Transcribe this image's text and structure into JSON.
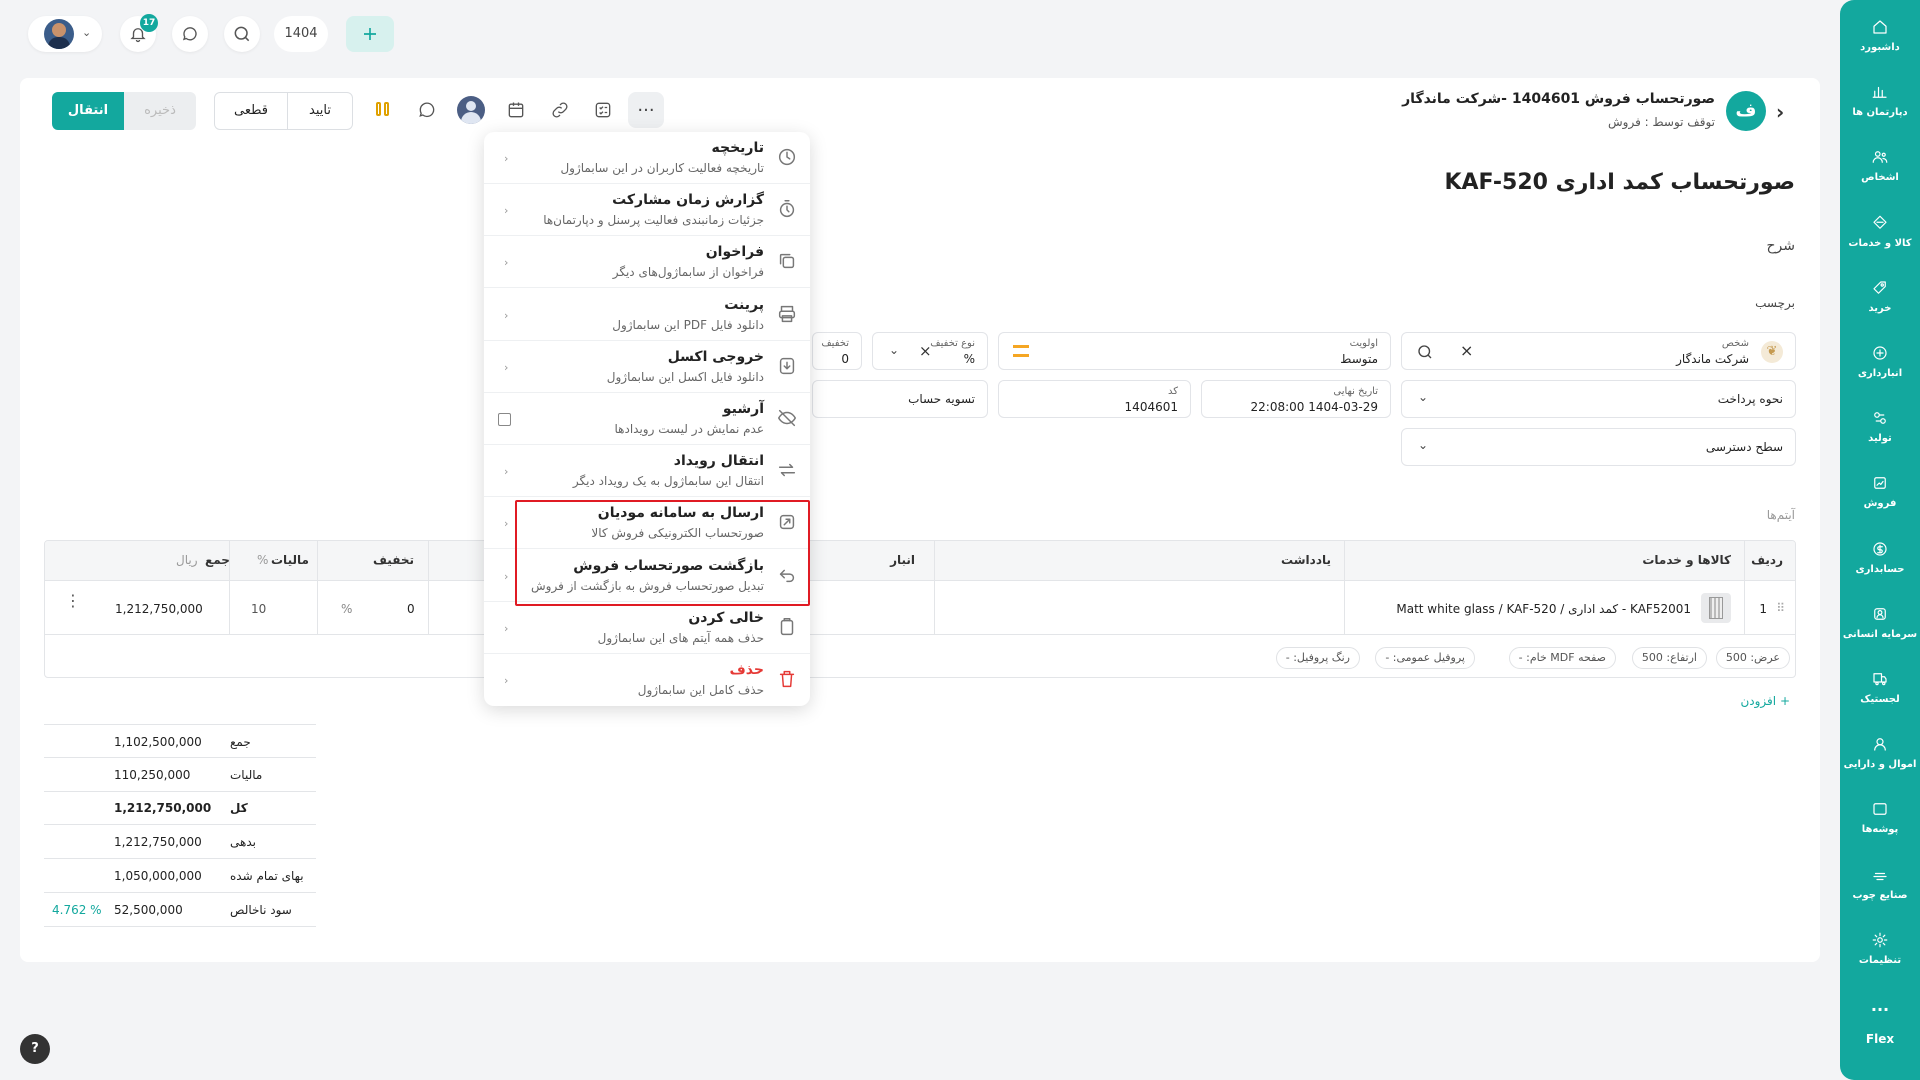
{
  "topbar": {
    "notif_count": "17",
    "year": "1404"
  },
  "sidebar": [
    {
      "label": "داشبورد",
      "icon": "home-icon"
    },
    {
      "label": "دپارتمان ها",
      "icon": "chart-icon"
    },
    {
      "label": "اشخاص",
      "icon": "users-icon"
    },
    {
      "label": "کالا و خدمات",
      "icon": "box-icon"
    },
    {
      "label": "خرید",
      "icon": "tag-icon"
    },
    {
      "label": "انبارداری",
      "icon": "warehouse-icon"
    },
    {
      "label": "تولید",
      "icon": "factory-icon"
    },
    {
      "label": "فروش",
      "icon": "sales-icon"
    },
    {
      "label": "حسابداری",
      "icon": "dollar-icon"
    },
    {
      "label": "سرمایه انسانی",
      "icon": "person-icon"
    },
    {
      "label": "لجستیک",
      "icon": "truck-icon"
    },
    {
      "label": "اموال و دارایی",
      "icon": "asset-icon"
    },
    {
      "label": "پوشه‌ها",
      "icon": "folder-icon"
    },
    {
      "label": "صنایع چوب",
      "icon": "wood-icon"
    },
    {
      "label": "تنظیمات",
      "icon": "gear-icon"
    }
  ],
  "sidebar_more": "...",
  "brand": "Flex",
  "header": {
    "avatar_letter": "ف",
    "title": "صورتحساب فروش 1404601 -شرکت ماندگار",
    "subtitle": "توقف توسط : فروش"
  },
  "actions": {
    "transfer": "انتقال",
    "save": "ذخیره",
    "approve": "تایید",
    "final": "قطعی"
  },
  "page_title": "صورتحساب کمد اداری KAF-520",
  "labels": {
    "description": "شرح",
    "tag": "برچسب"
  },
  "fields": {
    "person": {
      "label": "شخص",
      "value": "شرکت ماندگار"
    },
    "priority": {
      "label": "اولویت",
      "value": "متوسط"
    },
    "discount_type": {
      "label": "نوع تخفیف",
      "value": "%"
    },
    "discount": {
      "label": "تخفیف",
      "value": "0"
    },
    "payment": {
      "label": "نحوه پرداخت"
    },
    "due_date": {
      "label": "تاریخ نهایی",
      "value": "1404-03-29 22:08:00"
    },
    "code": {
      "label": "کد",
      "value": "1404601"
    },
    "settlement": {
      "value": "تسویه حساب"
    },
    "access": {
      "label": "سطح دسترسی"
    }
  },
  "menu": [
    {
      "title": "تاریخچه",
      "sub": "تاریخچه فعالیت کاربران در این سابماژول",
      "icon": "clock-icon"
    },
    {
      "title": "گزارش زمان مشارکت",
      "sub": "جزئیات زمانبندی فعالیت پرسنل و دپارتمان‌ها",
      "icon": "timer-icon"
    },
    {
      "title": "فراخوان",
      "sub": "فراخوان از سابماژول‌های دیگر",
      "icon": "copy-icon"
    },
    {
      "title": "پرینت",
      "sub": "دانلود فایل PDF این سابماژول",
      "icon": "printer-icon"
    },
    {
      "title": "خروجی اکسل",
      "sub": "دانلود فایل اکسل این سابماژول",
      "icon": "download-icon"
    },
    {
      "title": "آرشیو",
      "sub": "عدم نمایش در لیست رویدادها",
      "icon": "eye-off-icon"
    },
    {
      "title": "انتقال رویداد",
      "sub": "انتقال این سابماژول به یک رویداد دیگر",
      "icon": "swap-icon"
    },
    {
      "title": "ارسال به سامانه مودیان",
      "sub": "صورتحساب الکترونیکی فروش کالا",
      "icon": "send-icon"
    },
    {
      "title": "بازگشت صورتحساب فروش",
      "sub": "تبدیل صورتحساب فروش به بازگشت از فروش",
      "icon": "return-icon"
    },
    {
      "title": "خالی کردن",
      "sub": "حذف همه آیتم های این سابماژول",
      "icon": "clipboard-icon"
    },
    {
      "title": "حذف",
      "sub": "حذف کامل این سابماژول",
      "icon": "trash-icon"
    }
  ],
  "items_label": "آیتم‌ها",
  "table": {
    "headers": {
      "row": "ردیف",
      "goods": "کالاها و خدمات",
      "note": "یادداشت",
      "warehouse": "انبار",
      "discount": "تخفیف",
      "tax": "مالیات",
      "tax_unit": "%",
      "total": "جمع",
      "total_unit": "ریال"
    },
    "row": {
      "index": "1",
      "goods": "KAF52001 - کمد اداری / Matt white glass / KAF-520",
      "discount": "0",
      "discount_unit": "%",
      "tax": "10",
      "total": "1,212,750,000"
    },
    "chips": [
      "عرض: 500",
      "ارتفاع: 500",
      "صفحه MDF خام: -",
      "پروفیل عمومی: -",
      "رنگ پروفیل: -"
    ]
  },
  "add_label": "+ افزودن",
  "summary": [
    {
      "label": "جمع",
      "value": "1,102,500,000"
    },
    {
      "label": "مالیات",
      "value": "110,250,000"
    },
    {
      "label": "کل",
      "value": "1,212,750,000"
    },
    {
      "label": "بدهی",
      "value": "1,212,750,000"
    },
    {
      "label": "بهای تمام شده",
      "value": "1,050,000,000"
    },
    {
      "label": "سود ناخالص",
      "value": "52,500,000",
      "extra": "4.762 %"
    }
  ],
  "help": "?",
  "colors": {
    "primary": "#13a89e",
    "danger": "#e53935",
    "highlight": "#e01b24"
  }
}
